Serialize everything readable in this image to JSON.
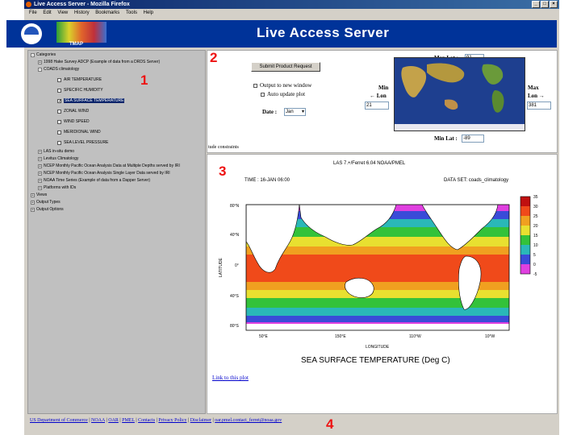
{
  "window": {
    "title": "Live Access Server - Mozilla Firefox"
  },
  "menu": [
    "File",
    "Edit",
    "View",
    "History",
    "Bookmarks",
    "Tools",
    "Help"
  ],
  "banner": {
    "title": "Live Access Server",
    "tmap_label": "TMAP"
  },
  "tree": {
    "categories_label": "Categories",
    "items": [
      {
        "label": "1998 Hake Survey ADCP (Example of data from a DRDS Server)",
        "toggle": "+"
      },
      {
        "label": "COADS climatology",
        "toggle": "-"
      },
      {
        "label": "AIR TEMPERATURE",
        "checked": false
      },
      {
        "label": "SPECIFIC HUMIDITY",
        "checked": false
      },
      {
        "label": "SEA SURFACE TEMPERATURE",
        "checked": true,
        "selected": true
      },
      {
        "label": "ZONAL WIND",
        "checked": false
      },
      {
        "label": "WIND SPEED",
        "checked": false
      },
      {
        "label": "MERIDIONAL WIND",
        "checked": false
      },
      {
        "label": "SEA LEVEL PRESSURE",
        "checked": false
      },
      {
        "label": "LAS in-situ demo",
        "toggle": "+"
      },
      {
        "label": "Levitus Climatology",
        "toggle": "+"
      },
      {
        "label": "NCEP Monthly Pacific Ocean Analysis Data at Multiple Depths served by IRI",
        "toggle": "+"
      },
      {
        "label": "NCEP Monthly Pacific Ocean Analysis Single Layer Data served by IRI",
        "toggle": "+"
      },
      {
        "label": "NOAA Time Series (Example of data from a Dapper Server)",
        "toggle": "+"
      },
      {
        "label": "Platforms with IDs",
        "toggle": "+"
      },
      {
        "label": "Views",
        "toggle": "+"
      },
      {
        "label": "Output Types",
        "toggle": "+"
      },
      {
        "label": "Output Options",
        "toggle": "+"
      }
    ]
  },
  "controls": {
    "submit_label": "Submit Product Request",
    "output_new_window": "Output to new window",
    "auto_update": "Auto update plot",
    "date_label": "Date :",
    "date_value": "Jan",
    "max_lat_label": "Max Lat :",
    "max_lat_value": "91",
    "min_lat_label": "Min Lat :",
    "min_lat_value": "-89",
    "min_lon_label": "Min",
    "min_lon_sub": "← Lon",
    "min_lon_value": "21",
    "max_lon_label": "Max",
    "max_lon_sub": "Lon →",
    "max_lon_value": "381",
    "constraints_text": "tude constraints"
  },
  "plot": {
    "header": "LAS 7.+/Ferret 6.04     NOAA/PMEL",
    "time": "TIME : 16-JAN 06:00",
    "dataset": "DATA SET: coads_climatology",
    "ylabel": "LATITUDE",
    "xlabel": "LONGITUDE",
    "title": "SEA SURFACE TEMPERATURE (Deg C)",
    "lat_ticks": [
      "80°N",
      "40°N",
      "0°",
      "40°S",
      "80°S"
    ],
    "lon_ticks": [
      "50°E",
      "150°E",
      "110°W",
      "10°W"
    ],
    "colorbar_ticks": [
      "35",
      "30",
      "25",
      "20",
      "15",
      "10",
      "5",
      "0",
      "-5"
    ],
    "link_text": "Link to this plot"
  },
  "footer_links": [
    "US Department of Commerce",
    "NOAA",
    "OAR",
    "PMEL",
    "Contacts",
    "Privacy Policy",
    "Disclaimer",
    "oar.pmel.contact_ferret@noaa.gov"
  ],
  "annotations": [
    "1",
    "2",
    "3",
    "4"
  ],
  "colors": {
    "banner": "#003399",
    "annotation": "#ee1111",
    "link": "#0000cc"
  }
}
